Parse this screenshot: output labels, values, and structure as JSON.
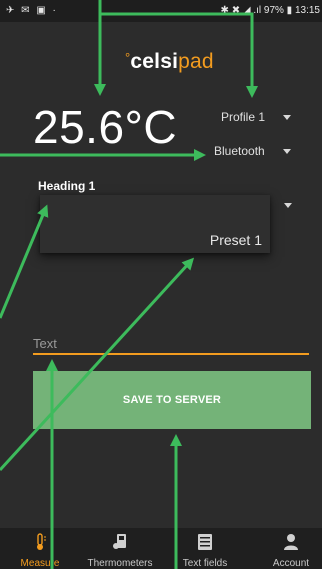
{
  "status_bar": {
    "left_icons": "✈ ✉ ▣ ·",
    "right_text": "✱ ✖ ◢ .ıl 97% ▮ 13:15"
  },
  "logo": {
    "degree": "°",
    "brand_a": "celsi",
    "brand_b": "pad"
  },
  "measurement": {
    "temperature": "25.6°C"
  },
  "selects": {
    "profile": "Profile 1",
    "connection": "Bluetooth"
  },
  "heading": {
    "label": "Heading 1",
    "selected_option": "Preset 1"
  },
  "text_field": {
    "placeholder": "Text",
    "value": ""
  },
  "save": {
    "label": "SAVE TO SERVER"
  },
  "nav": {
    "items": [
      {
        "label": "Measure",
        "icon": "thermometer-icon",
        "active": true
      },
      {
        "label": "Thermometers",
        "icon": "thermometers-icon",
        "active": false
      },
      {
        "label": "Text fields",
        "icon": "text-fields-icon",
        "active": false
      },
      {
        "label": "Account",
        "icon": "account-icon",
        "active": false
      }
    ]
  },
  "colors": {
    "accent": "#f39c1f",
    "button": "#74b378",
    "background": "#2c2c2c",
    "annotation_arrow": "#3dbb5c"
  }
}
